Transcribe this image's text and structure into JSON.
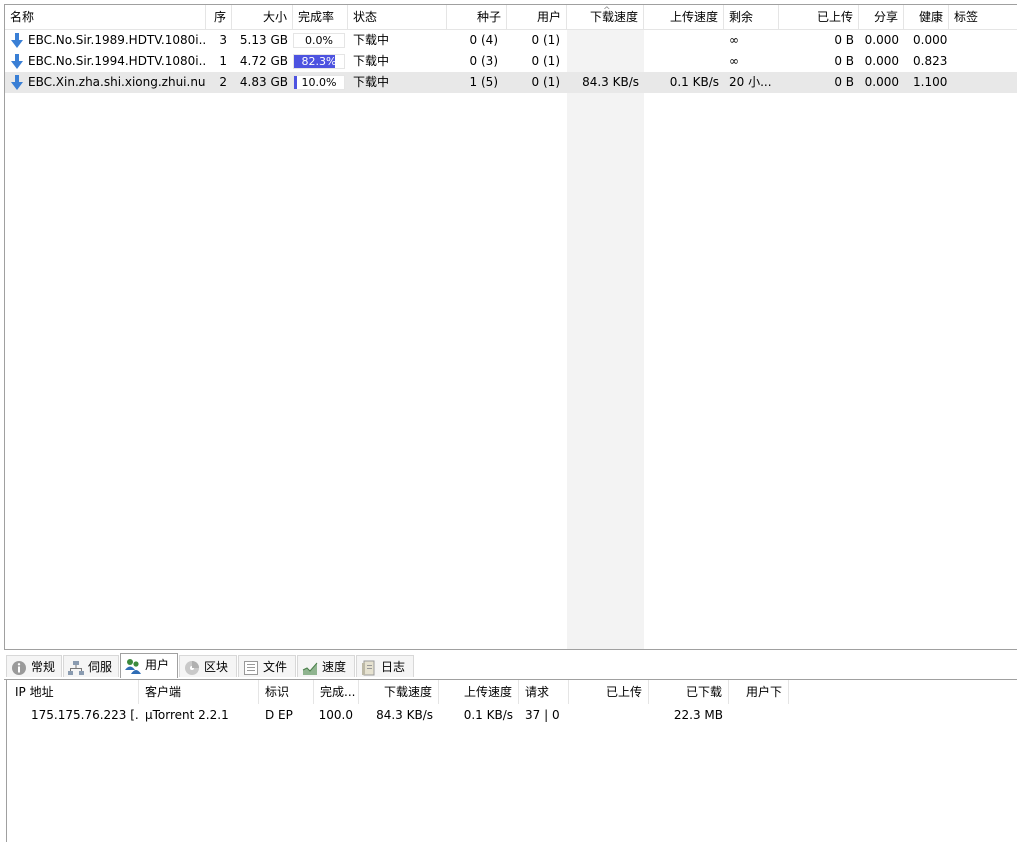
{
  "torrent_list": {
    "columns": {
      "name": "名称",
      "queue": "序",
      "size": "大小",
      "done": "完成率",
      "status": "状态",
      "seeds": "种子",
      "peers": "用户",
      "down_speed": "下载速度",
      "up_speed": "上传速度",
      "eta": "剩余",
      "uploaded": "已上传",
      "ratio": "分享",
      "availability": "健康",
      "label": "标签"
    },
    "rows": [
      {
        "name": "EBC.No.Sir.1989.HDTV.1080i....",
        "queue": "3",
        "size": "5.13 GB",
        "progress_text": "0.0%",
        "progress": 0.0,
        "status": "下载中",
        "seeds": "0 (4)",
        "peers": "0 (1)",
        "down_speed": "",
        "up_speed": "",
        "eta": "∞",
        "uploaded": "0 B",
        "ratio": "0.000",
        "availability": "0.000"
      },
      {
        "name": "EBC.No.Sir.1994.HDTV.1080i....",
        "queue": "1",
        "size": "4.72 GB",
        "progress_text": "82.3%",
        "progress": 0.823,
        "status": "下载中",
        "seeds": "0 (3)",
        "peers": "0 (1)",
        "down_speed": "",
        "up_speed": "",
        "eta": "∞",
        "uploaded": "0 B",
        "ratio": "0.000",
        "availability": "0.823"
      },
      {
        "name": "EBC.Xin.zha.shi.xiong.zhui.nu....",
        "queue": "2",
        "size": "4.83 GB",
        "progress_text": "10.0%",
        "progress": 0.1,
        "status": "下载中",
        "seeds": "1 (5)",
        "peers": "0 (1)",
        "down_speed": "84.3 KB/s",
        "up_speed": "0.1 KB/s",
        "eta": "20 小...",
        "uploaded": "0 B",
        "ratio": "0.000",
        "availability": "1.100"
      }
    ]
  },
  "tabs": [
    {
      "label": "常规",
      "icon": "info-icon"
    },
    {
      "label": "伺服",
      "icon": "trackers-icon"
    },
    {
      "label": "用户",
      "icon": "peers-icon",
      "active": true
    },
    {
      "label": "区块",
      "icon": "pieces-icon"
    },
    {
      "label": "文件",
      "icon": "files-icon"
    },
    {
      "label": "速度",
      "icon": "speed-graph-icon"
    },
    {
      "label": "日志",
      "icon": "logger-icon"
    }
  ],
  "peers": {
    "columns": {
      "ip": "IP 地址",
      "client": "客户端",
      "flags": "标识",
      "percent": "完成...",
      "down_speed": "下载速度",
      "up_speed": "上传速度",
      "reqs": "请求",
      "uploaded": "已上传",
      "downloaded": "已下载",
      "peer_dl": "用户下"
    },
    "rows": [
      {
        "ip": "175.175.76.223 [...",
        "client": "µTorrent 2.2.1",
        "flags": "D EP",
        "percent": "100.0",
        "down_speed": "84.3 KB/s",
        "up_speed": "0.1 KB/s",
        "reqs": "37 | 0",
        "uploaded": "",
        "downloaded": "22.3 MB",
        "peer_dl": ""
      }
    ]
  },
  "colors": {
    "progress_fill": "#4d53e0",
    "download_arrow": "#3a7fd5",
    "selected_row": "#e8e8e8"
  }
}
